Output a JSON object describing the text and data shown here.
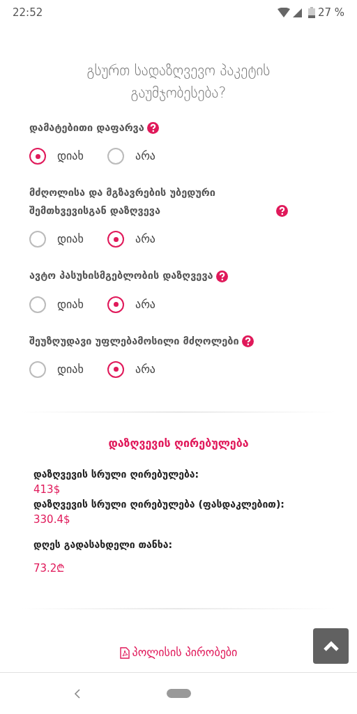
{
  "status_bar": {
    "time": "22:52",
    "battery": "27 %"
  },
  "title": "გსურთ სადაზღვევო პაკეტის გაუმჯობესება?",
  "questions": [
    {
      "label": "დამატებითი დაფარვა",
      "options": [
        {
          "label": "დიახ",
          "selected": true
        },
        {
          "label": "არა",
          "selected": false
        }
      ]
    },
    {
      "label": "მძღოლისა და მგზავრების უბედური შემთხვევისგან დაზღვევა",
      "options": [
        {
          "label": "დიახ",
          "selected": false
        },
        {
          "label": "არა",
          "selected": true
        }
      ]
    },
    {
      "label": "ავტო პასუხისმგებლობის დაზღვევა",
      "options": [
        {
          "label": "დიახ",
          "selected": false
        },
        {
          "label": "არა",
          "selected": true
        }
      ]
    },
    {
      "label": "შეუზღუდავი უფლებამოსილი მძღოლები",
      "options": [
        {
          "label": "დიახ",
          "selected": false
        },
        {
          "label": "არა",
          "selected": true
        }
      ]
    }
  ],
  "cost": {
    "title": "დაზღვევის ღირებულება",
    "items": [
      {
        "kind": "compact",
        "label": "დაზღვევის სრული ღირებულება:",
        "value": "413$"
      },
      {
        "kind": "compact",
        "label": "დაზღვევის სრული ღირებულება (ფასდაკლებით):",
        "value": "330.4$"
      },
      {
        "kind": "spaced",
        "label": "დღეს გადასახდელი თანხა:",
        "value": "73.2₾"
      }
    ]
  },
  "policy_link": "პოლისის პირობები"
}
